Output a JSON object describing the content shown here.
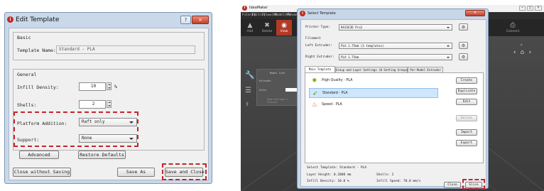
{
  "edit_dialog": {
    "title": "Edit Template",
    "help_button": "?",
    "close_button": "×",
    "basic": {
      "group_label": "Basic",
      "template_name_label": "Template Name:",
      "template_name_value": "Standard - PLA"
    },
    "general": {
      "group_label": "General",
      "infill_density_label": "Infill Density:",
      "infill_density_value": "10",
      "infill_density_unit": "%",
      "shells_label": "Shells:",
      "shells_value": "2",
      "platform_addition_label": "Platform Addition:",
      "platform_addition_value": "Raft only",
      "support_label": "Support:",
      "support_value": "None"
    },
    "buttons": {
      "advanced": "Advanced",
      "restore_defaults": "Restore Defaults",
      "close_without_saving": "Close without Saving",
      "save_as": "Save As",
      "save_and_close": "Save and Close"
    }
  },
  "main_window": {
    "title": "IdeaMaker",
    "menu": [
      "File(F)",
      "Edit(E)",
      "View(V)",
      "Model(M)",
      "Advanced"
    ],
    "toolbar": [
      {
        "label": "Add",
        "icon": "add-model-icon",
        "glyph": "▲"
      },
      {
        "label": "Delete",
        "icon": "delete-icon",
        "glyph": "✖"
      },
      {
        "label": "View",
        "icon": "view-icon",
        "glyph": "◉"
      },
      {
        "label": "Move",
        "icon": "move-icon",
        "glyph": "✥"
      }
    ],
    "connect_label": "Connect",
    "left_panel": {
      "model_info": "Model Info",
      "extruder": "Extruder",
      "color": "Color",
      "show_extruder": "Show Extruder's Preview"
    },
    "accent_color": "#b23a26"
  },
  "select_dialog": {
    "title": "Select Template",
    "printer_type_label": "Printer Type:",
    "printer_type_value": "RAISE3D Pro2",
    "filament_label": "Filament",
    "left_extruder_label": "Left Extruder:",
    "left_extruder_value": "PLA 1.75mm (3 templates)",
    "right_extruder_label": "Right Extruder:",
    "right_extruder_value": "PLA 1.75mm",
    "tabs": [
      "Main Template",
      "Group and Layer Settings (0 Setting Groups)",
      "Per-Model Extruder"
    ],
    "templates": [
      {
        "name": "High Quality - PLA",
        "icon": "high-quality-icon"
      },
      {
        "name": "Standard - PLA",
        "icon": "standard-icon"
      },
      {
        "name": "Speed - PLA",
        "icon": "speed-icon"
      }
    ],
    "side_buttons": {
      "create": "Create",
      "duplicate": "Duplicate",
      "edit": "Edit",
      "delete": "Delete",
      "import": "Import",
      "export": "Export"
    },
    "summary": {
      "select_template": "Select Template: Standard - PLA",
      "layer_height": "Layer Height: 0.2000 mm",
      "shells": "Shells: 2",
      "infill_density": "Infill Density: 10.0 %",
      "infill_speed": "Infill Speed: 70.0 mm/s"
    },
    "close_button": "Close",
    "slice_button": "Slice"
  },
  "highlight_color": "#c1272d"
}
